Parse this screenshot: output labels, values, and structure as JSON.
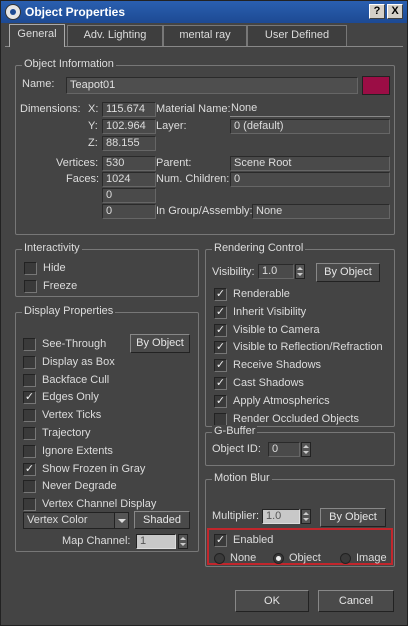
{
  "window": {
    "title": "Object Properties",
    "help_button": "?",
    "close_button": "X"
  },
  "tabs": [
    {
      "label": "General",
      "active": true
    },
    {
      "label": "Adv. Lighting",
      "active": false
    },
    {
      "label": "mental ray",
      "active": false
    },
    {
      "label": "User Defined",
      "active": false
    }
  ],
  "object_info": {
    "title": "Object Information",
    "name_label": "Name:",
    "name_value": "Teapot01",
    "color": "#9b0d45",
    "dimensions_label": "Dimensions:",
    "x_label": "X:",
    "x_value": "115.674",
    "y_label": "Y:",
    "y_value": "102.964",
    "z_label": "Z:",
    "z_value": "88.155",
    "vertices_label": "Vertices:",
    "vertices_value": "530",
    "faces_label": "Faces:",
    "faces_value": "1024",
    "extra1_value": "0",
    "extra2_value": "0",
    "material_label": "Material Name:",
    "material_value": "None",
    "layer_label": "Layer:",
    "layer_value": "0 (default)",
    "parent_label": "Parent:",
    "parent_value": "Scene Root",
    "children_label": "Num. Children:",
    "children_value": "0",
    "group_label": "In Group/Assembly:",
    "group_value": "None"
  },
  "interactivity": {
    "title": "Interactivity",
    "hide": {
      "label": "Hide",
      "checked": false
    },
    "freeze": {
      "label": "Freeze",
      "checked": false
    }
  },
  "display_properties": {
    "title": "Display Properties",
    "by_object_label": "By Object",
    "items": [
      {
        "label": "See-Through",
        "checked": false
      },
      {
        "label": "Display as Box",
        "checked": false
      },
      {
        "label": "Backface Cull",
        "checked": false
      },
      {
        "label": "Edges Only",
        "checked": true
      },
      {
        "label": "Vertex Ticks",
        "checked": false
      },
      {
        "label": "Trajectory",
        "checked": false
      },
      {
        "label": "Ignore Extents",
        "checked": false
      },
      {
        "label": "Show Frozen in Gray",
        "checked": true
      },
      {
        "label": "Never Degrade",
        "checked": false
      },
      {
        "label": "Vertex Channel Display",
        "checked": false
      }
    ],
    "vertex_color_label": "Vertex Color",
    "shaded_label": "Shaded",
    "map_channel_label": "Map Channel:",
    "map_channel_value": "1"
  },
  "rendering_control": {
    "title": "Rendering Control",
    "visibility_label": "Visibility:",
    "visibility_value": "1.0",
    "by_object_label": "By Object",
    "items": [
      {
        "label": "Renderable",
        "checked": true
      },
      {
        "label": "Inherit Visibility",
        "checked": true
      },
      {
        "label": "Visible to Camera",
        "checked": true
      },
      {
        "label": "Visible to Reflection/Refraction",
        "checked": true
      },
      {
        "label": "Receive Shadows",
        "checked": true
      },
      {
        "label": "Cast Shadows",
        "checked": true
      },
      {
        "label": "Apply Atmospherics",
        "checked": true
      },
      {
        "label": "Render Occluded Objects",
        "checked": false
      }
    ]
  },
  "gbuffer": {
    "title": "G-Buffer",
    "object_id_label": "Object ID:",
    "object_id_value": "0"
  },
  "motion_blur": {
    "title": "Motion Blur",
    "multiplier_label": "Multiplier:",
    "multiplier_value": "1.0",
    "by_object_label": "By Object",
    "enabled": {
      "label": "Enabled",
      "checked": true
    },
    "none_label": "None",
    "object_label": "Object",
    "image_label": "Image",
    "selected": "Object",
    "highlight_color": "#c2262c"
  },
  "footer": {
    "ok_label": "OK",
    "cancel_label": "Cancel"
  }
}
